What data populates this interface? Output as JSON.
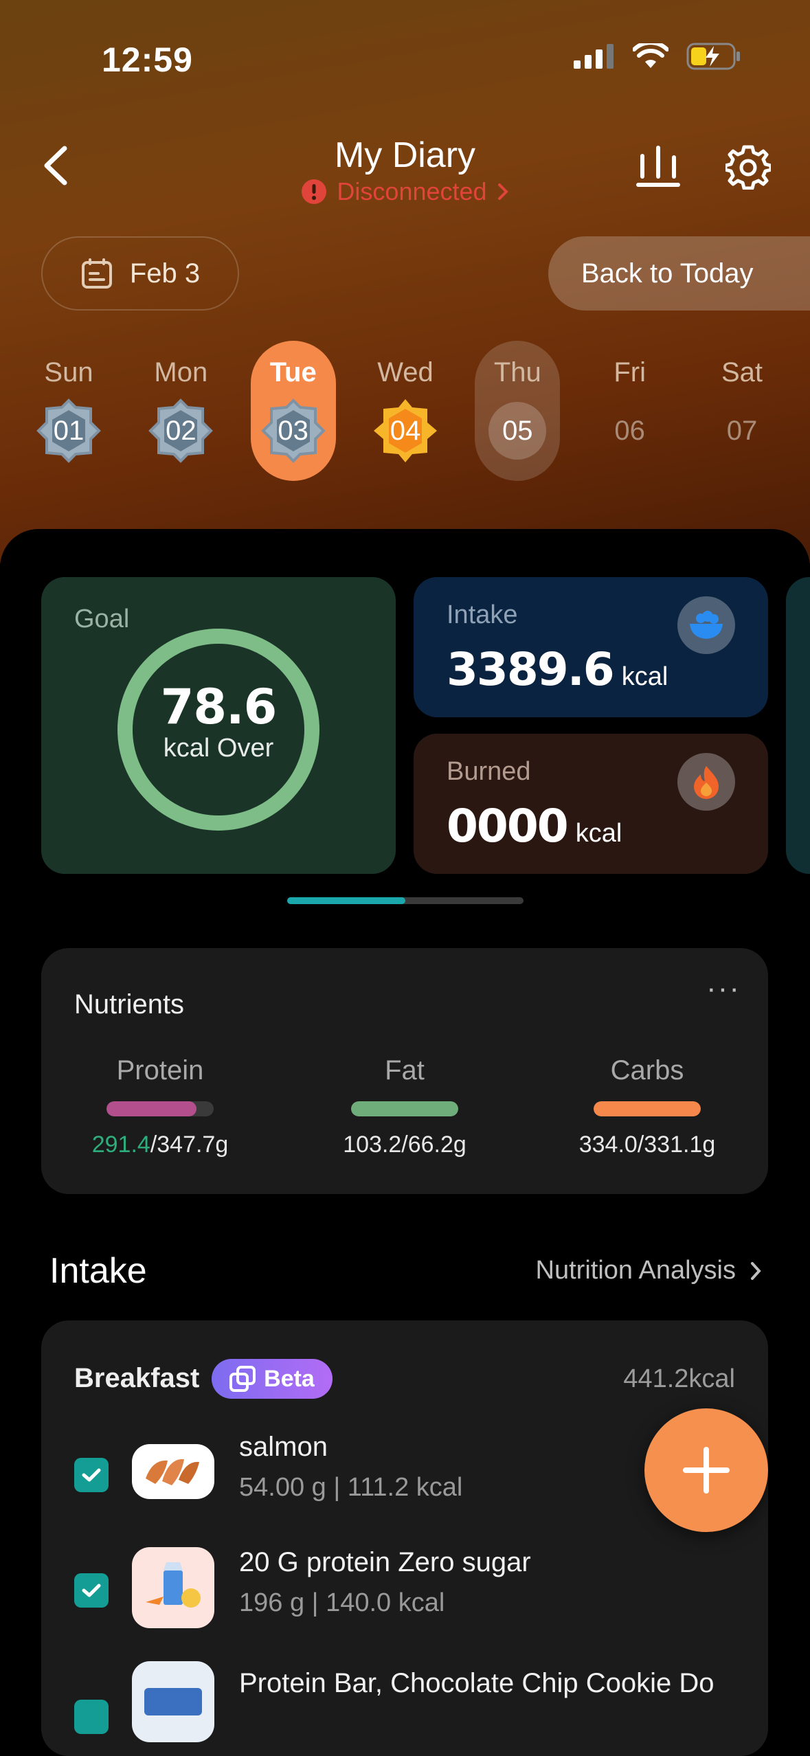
{
  "status_bar": {
    "time": "12:59"
  },
  "nav": {
    "title": "My Diary",
    "connection_status": "Disconnected",
    "date_label": "Feb 3",
    "back_to_today": "Back to Today"
  },
  "week": [
    {
      "name": "Sun",
      "num": "01",
      "state": "badge-gray"
    },
    {
      "name": "Mon",
      "num": "02",
      "state": "badge-gray"
    },
    {
      "name": "Tue",
      "num": "03",
      "state": "selected"
    },
    {
      "name": "Wed",
      "num": "04",
      "state": "badge-gold"
    },
    {
      "name": "Thu",
      "num": "05",
      "state": "today"
    },
    {
      "name": "Fri",
      "num": "06",
      "state": "plain"
    },
    {
      "name": "Sat",
      "num": "07",
      "state": "plain"
    }
  ],
  "summary": {
    "goal_label": "Goal",
    "goal_value": "78.6",
    "goal_sub": "kcal Over",
    "intake_label": "Intake",
    "intake_value": "3389.6",
    "intake_unit": "kcal",
    "burned_label": "Burned",
    "burned_value": "0000",
    "burned_unit": "kcal",
    "pager_progress": 0.5
  },
  "nutrients": {
    "title": "Nutrients",
    "more": "···",
    "protein": {
      "label": "Protein",
      "current": "291.4",
      "target": "/347.7g",
      "progress": 0.84,
      "color": "#b24f8c"
    },
    "fat": {
      "label": "Fat",
      "amount": "103.2/66.2g",
      "progress": 1.0,
      "color": "#6fae7a"
    },
    "carbs": {
      "label": "Carbs",
      "amount": "334.0/331.1g",
      "progress": 1.0,
      "color": "#f5884a"
    }
  },
  "intake_section": {
    "title": "Intake",
    "analysis_link": "Nutrition Analysis"
  },
  "breakfast": {
    "title": "Breakfast",
    "badge": "Beta",
    "calories": "441.2kcal",
    "items": [
      {
        "name": "salmon",
        "detail": "54.00 g | 111.2 kcal"
      },
      {
        "name": "20 G protein Zero  sugar",
        "detail": "196 g | 140.0 kcal"
      },
      {
        "name": "Protein Bar, Chocolate Chip Cookie Do",
        "detail": ""
      }
    ]
  },
  "colors": {
    "accent_orange": "#f6904f",
    "error_red": "#e0443a",
    "check_teal": "#139d94"
  }
}
